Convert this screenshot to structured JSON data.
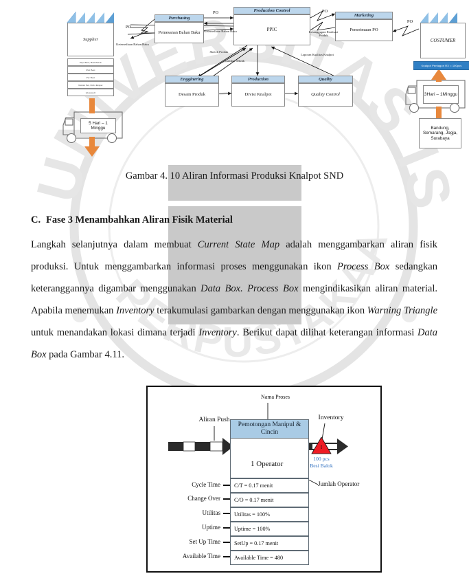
{
  "watermark": {
    "arc_top": "UNIVERSITAS ISLAM BANDUNG",
    "arc_bottom": "PERPUSTAKAAN"
  },
  "figure1": {
    "supplier": {
      "title": "Supplier",
      "rows": [
        "Pipa Besi, Besi Balok",
        "Plat Besi",
        "Per Besi",
        "Kaitan Per, Pelia Respet",
        "Glasswoll"
      ]
    },
    "customer": {
      "title": "COSTUMER"
    },
    "nodes": [
      {
        "header": "Purchasing",
        "body": "Pemesanan Bahan Baku"
      },
      {
        "header": "Production Control",
        "body": "PPIC"
      },
      {
        "header": "Marketing",
        "body": "Penerimaan PO"
      },
      {
        "header": "Engginering",
        "body": "Desain Produk"
      },
      {
        "header": "Production",
        "body": "Divisi Knalpot"
      },
      {
        "header": "Quality",
        "body": "Quality Control"
      }
    ],
    "arrow_labels": {
      "po_supplier": "PO",
      "po_purch_pc": "PO",
      "po_mkt_pc": "PO",
      "po_customer": "PO",
      "ketersediaan_supplier": "Ketersediaan Bahan Baku",
      "ketersediaan_pc": "Ketersediaan Bahan Baku",
      "kesanggupan": "Kesanggupan Realisasi Produk",
      "sketch": "Sketch Produk",
      "gambar": "Gambar Teknik",
      "laporan": "Laporan Kualitas Knalpot"
    },
    "left_truck_box": "5 Hari – 1 Minggu",
    "right_truck_box": "3Hari – 1Minggu",
    "right_city_box": "Bandung, Semarang, Jogja, Surabaya",
    "right_banner": "Knalpot Pentagon RX = 100pcs"
  },
  "caption1": "Gambar 4. 10 Aliran Informasi Produksi Knalpot SND",
  "section": {
    "marker": "C.",
    "heading": "Fase 3 Menambahkan Aliran Fisik Material",
    "paragraph_runs": [
      {
        "t": "Langkah selanjutnya dalam membuat "
      },
      {
        "t": "Current State Map",
        "i": true
      },
      {
        "t": " adalah menggambarkan aliran fisik produksi. Untuk menggambarkan informasi proses menggunakan ikon "
      },
      {
        "t": "Process Box",
        "i": true
      },
      {
        "t": " sedangkan keteranggannya digambar menggunakan "
      },
      {
        "t": "Data Box. Process Box",
        "i": true
      },
      {
        "t": " mengindikasikan aliran material. Apabila menemukan "
      },
      {
        "t": "Inventory",
        "i": true
      },
      {
        "t": " terakumulasi gambarkan dengan menggunakan ikon "
      },
      {
        "t": "Warning Triangle",
        "i": true
      },
      {
        "t": " untuk menandakan lokasi dimana terjadi "
      },
      {
        "t": "Inventory",
        "i": true
      },
      {
        "t": ". Berikut dapat dilihat keterangan informasi "
      },
      {
        "t": "Data Box",
        "i": true
      },
      {
        "t": " pada Gambar 4.11."
      }
    ]
  },
  "figure2": {
    "nama_proses_label": "Nama Proses",
    "process_name": "Pemotongan Manipul & Cincin",
    "aliran_push_label": "Aliran Push",
    "inventory_label": "Inventory",
    "inventory_symbol": "I",
    "inventory_qty": "100 pcs",
    "inventory_item": "Besi Balok",
    "operator_count": "1 Operator",
    "operator_annotation": "Jumlah Operator",
    "left_labels": [
      "Cycle Time",
      "Change Over",
      "Utilitas",
      "Uptime",
      "Set Up Time",
      "Available Time"
    ],
    "data_rows": [
      "C/T = 0.17 menit",
      "C/O = 0.17 menit",
      "Utilitas = 100%",
      "Uptime = 100%",
      "SetUp = 0.17 menit",
      "Available Time = 480"
    ]
  },
  "colors": {
    "header_blue": "#bcd6ec",
    "process_blue": "#a9cbe5",
    "inventory_red": "#ee1b24",
    "orange_arrow": "#e8883c",
    "link_blue": "#2f6fbf"
  }
}
